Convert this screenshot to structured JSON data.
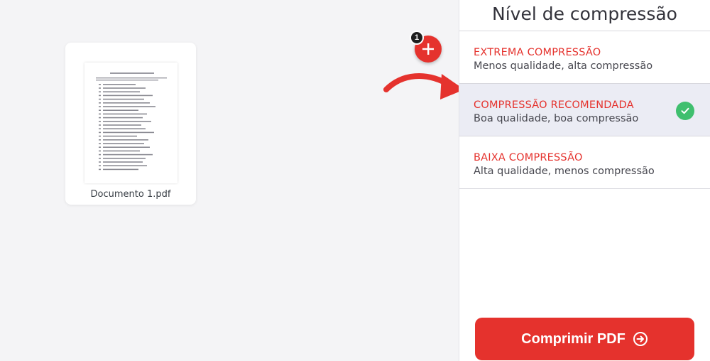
{
  "workspace": {
    "file": {
      "name": "Documento 1.pdf"
    },
    "add_button": {
      "icon": "plus-icon",
      "badge_count": "1"
    },
    "annotation": {
      "icon": "curved-arrow-icon",
      "color": "#e5322d"
    }
  },
  "sidebar": {
    "title": "Nível de compressão",
    "options": [
      {
        "title": "EXTREMA COMPRESSÃO",
        "subtitle": "Menos qualidade, alta compressão",
        "selected": false
      },
      {
        "title": "COMPRESSÃO RECOMENDADA",
        "subtitle": "Boa qualidade, boa compressão",
        "selected": true
      },
      {
        "title": "BAIXA COMPRESSÃO",
        "subtitle": "Alta qualidade, menos compressão",
        "selected": false
      }
    ],
    "selected_icon": "check-circle-icon",
    "action_button": {
      "label": "Comprimir PDF",
      "icon": "arrow-right-circle-icon"
    }
  },
  "colors": {
    "accent": "#e5322d",
    "check": "#3fbf6e",
    "selected_bg": "#ebecf4"
  }
}
